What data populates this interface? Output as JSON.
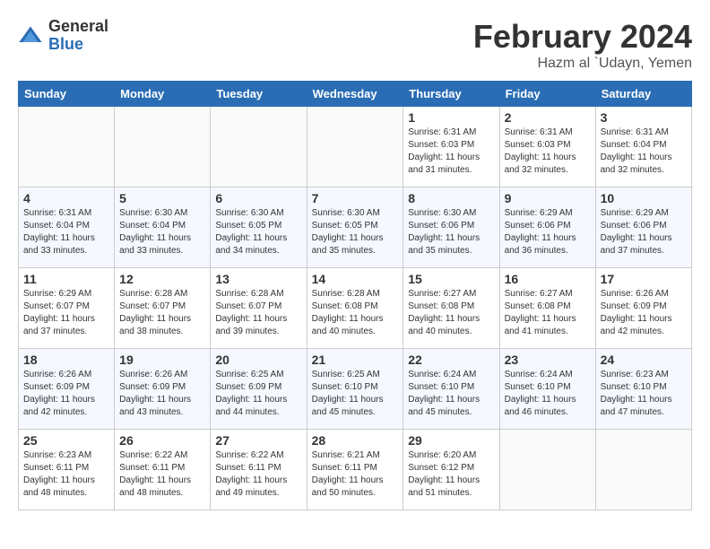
{
  "logo": {
    "general": "General",
    "blue": "Blue"
  },
  "title": {
    "month_year": "February 2024",
    "location": "Hazm al `Udayn, Yemen"
  },
  "weekdays": [
    "Sunday",
    "Monday",
    "Tuesday",
    "Wednesday",
    "Thursday",
    "Friday",
    "Saturday"
  ],
  "weeks": [
    [
      {
        "day": "",
        "info": ""
      },
      {
        "day": "",
        "info": ""
      },
      {
        "day": "",
        "info": ""
      },
      {
        "day": "",
        "info": ""
      },
      {
        "day": "1",
        "info": "Sunrise: 6:31 AM\nSunset: 6:03 PM\nDaylight: 11 hours and 31 minutes."
      },
      {
        "day": "2",
        "info": "Sunrise: 6:31 AM\nSunset: 6:03 PM\nDaylight: 11 hours and 32 minutes."
      },
      {
        "day": "3",
        "info": "Sunrise: 6:31 AM\nSunset: 6:04 PM\nDaylight: 11 hours and 32 minutes."
      }
    ],
    [
      {
        "day": "4",
        "info": "Sunrise: 6:31 AM\nSunset: 6:04 PM\nDaylight: 11 hours and 33 minutes."
      },
      {
        "day": "5",
        "info": "Sunrise: 6:30 AM\nSunset: 6:04 PM\nDaylight: 11 hours and 33 minutes."
      },
      {
        "day": "6",
        "info": "Sunrise: 6:30 AM\nSunset: 6:05 PM\nDaylight: 11 hours and 34 minutes."
      },
      {
        "day": "7",
        "info": "Sunrise: 6:30 AM\nSunset: 6:05 PM\nDaylight: 11 hours and 35 minutes."
      },
      {
        "day": "8",
        "info": "Sunrise: 6:30 AM\nSunset: 6:06 PM\nDaylight: 11 hours and 35 minutes."
      },
      {
        "day": "9",
        "info": "Sunrise: 6:29 AM\nSunset: 6:06 PM\nDaylight: 11 hours and 36 minutes."
      },
      {
        "day": "10",
        "info": "Sunrise: 6:29 AM\nSunset: 6:06 PM\nDaylight: 11 hours and 37 minutes."
      }
    ],
    [
      {
        "day": "11",
        "info": "Sunrise: 6:29 AM\nSunset: 6:07 PM\nDaylight: 11 hours and 37 minutes."
      },
      {
        "day": "12",
        "info": "Sunrise: 6:28 AM\nSunset: 6:07 PM\nDaylight: 11 hours and 38 minutes."
      },
      {
        "day": "13",
        "info": "Sunrise: 6:28 AM\nSunset: 6:07 PM\nDaylight: 11 hours and 39 minutes."
      },
      {
        "day": "14",
        "info": "Sunrise: 6:28 AM\nSunset: 6:08 PM\nDaylight: 11 hours and 40 minutes."
      },
      {
        "day": "15",
        "info": "Sunrise: 6:27 AM\nSunset: 6:08 PM\nDaylight: 11 hours and 40 minutes."
      },
      {
        "day": "16",
        "info": "Sunrise: 6:27 AM\nSunset: 6:08 PM\nDaylight: 11 hours and 41 minutes."
      },
      {
        "day": "17",
        "info": "Sunrise: 6:26 AM\nSunset: 6:09 PM\nDaylight: 11 hours and 42 minutes."
      }
    ],
    [
      {
        "day": "18",
        "info": "Sunrise: 6:26 AM\nSunset: 6:09 PM\nDaylight: 11 hours and 42 minutes."
      },
      {
        "day": "19",
        "info": "Sunrise: 6:26 AM\nSunset: 6:09 PM\nDaylight: 11 hours and 43 minutes."
      },
      {
        "day": "20",
        "info": "Sunrise: 6:25 AM\nSunset: 6:09 PM\nDaylight: 11 hours and 44 minutes."
      },
      {
        "day": "21",
        "info": "Sunrise: 6:25 AM\nSunset: 6:10 PM\nDaylight: 11 hours and 45 minutes."
      },
      {
        "day": "22",
        "info": "Sunrise: 6:24 AM\nSunset: 6:10 PM\nDaylight: 11 hours and 45 minutes."
      },
      {
        "day": "23",
        "info": "Sunrise: 6:24 AM\nSunset: 6:10 PM\nDaylight: 11 hours and 46 minutes."
      },
      {
        "day": "24",
        "info": "Sunrise: 6:23 AM\nSunset: 6:10 PM\nDaylight: 11 hours and 47 minutes."
      }
    ],
    [
      {
        "day": "25",
        "info": "Sunrise: 6:23 AM\nSunset: 6:11 PM\nDaylight: 11 hours and 48 minutes."
      },
      {
        "day": "26",
        "info": "Sunrise: 6:22 AM\nSunset: 6:11 PM\nDaylight: 11 hours and 48 minutes."
      },
      {
        "day": "27",
        "info": "Sunrise: 6:22 AM\nSunset: 6:11 PM\nDaylight: 11 hours and 49 minutes."
      },
      {
        "day": "28",
        "info": "Sunrise: 6:21 AM\nSunset: 6:11 PM\nDaylight: 11 hours and 50 minutes."
      },
      {
        "day": "29",
        "info": "Sunrise: 6:20 AM\nSunset: 6:12 PM\nDaylight: 11 hours and 51 minutes."
      },
      {
        "day": "",
        "info": ""
      },
      {
        "day": "",
        "info": ""
      }
    ]
  ]
}
